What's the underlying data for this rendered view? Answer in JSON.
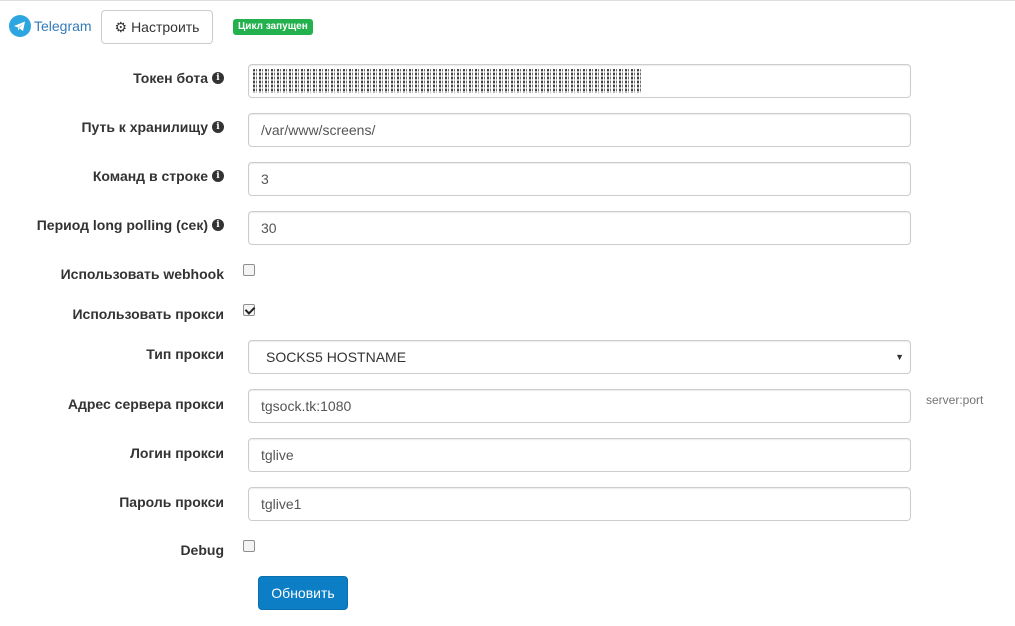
{
  "header": {
    "brand_label": "Telegram",
    "configure_label": "Настроить",
    "status_badge": "Цикл запущен"
  },
  "form": {
    "token": {
      "label": "Токен бота",
      "value": ""
    },
    "storage_path": {
      "label": "Путь к хранилищу",
      "value": "/var/www/screens/"
    },
    "commands_per_row": {
      "label": "Команд в строке",
      "value": "3"
    },
    "polling_period": {
      "label": "Период long polling (сек)",
      "value": "30"
    },
    "use_webhook": {
      "label": "Использовать webhook",
      "checked": false
    },
    "use_proxy": {
      "label": "Использовать прокси",
      "checked": true
    },
    "proxy_type": {
      "label": "Тип прокси",
      "value": "SOCKS5 HOSTNAME"
    },
    "proxy_address": {
      "label": "Адрес сервера прокси",
      "value": "tgsock.tk:1080",
      "help": "server:port"
    },
    "proxy_login": {
      "label": "Логин прокси",
      "value": "tglive"
    },
    "proxy_password": {
      "label": "Пароль прокси",
      "value": "tglive1"
    },
    "debug": {
      "label": "Debug",
      "checked": false
    },
    "submit_label": "Обновить"
  },
  "colors": {
    "brand": "#2ca5e0",
    "link": "#337ab7",
    "status_badge": "#22b14c",
    "primary_button": "#0b7ec5"
  },
  "icons": {
    "brand": "telegram-logo-icon",
    "configure": "gear-icon",
    "info": "info-icon",
    "select_caret": "caret-down-icon"
  }
}
